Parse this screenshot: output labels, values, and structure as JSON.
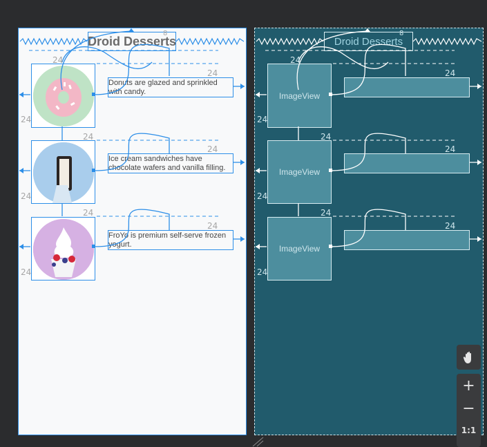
{
  "design": {
    "title": "Droid Desserts",
    "items": [
      {
        "description": "Donuts are glazed and sprinkled with candy.",
        "image": "donut-image"
      },
      {
        "description": "Ice cream sandwiches have chocolate wafers and vanilla filling.",
        "image": "ice-cream-sandwich-image"
      },
      {
        "description": "FroYo is premium self-serve frozen yogurt.",
        "image": "froyo-image"
      }
    ]
  },
  "blueprint": {
    "title": "Droid Desserts",
    "items": [
      {
        "image_label": "ImageView"
      },
      {
        "image_label": "ImageView"
      },
      {
        "image_label": "ImageView"
      }
    ]
  },
  "margins": {
    "standard": "24",
    "title": "8"
  },
  "zoom_controls": {
    "fit": "1:1"
  },
  "icons": {
    "pan": "hand-icon",
    "zoom_in": "plus-icon",
    "zoom_out": "minus-icon"
  },
  "colors": {
    "constraint_blue": "#2c8ee8",
    "blueprint_bg": "#215b6c",
    "canvas_bg": "#2b2c2e"
  }
}
